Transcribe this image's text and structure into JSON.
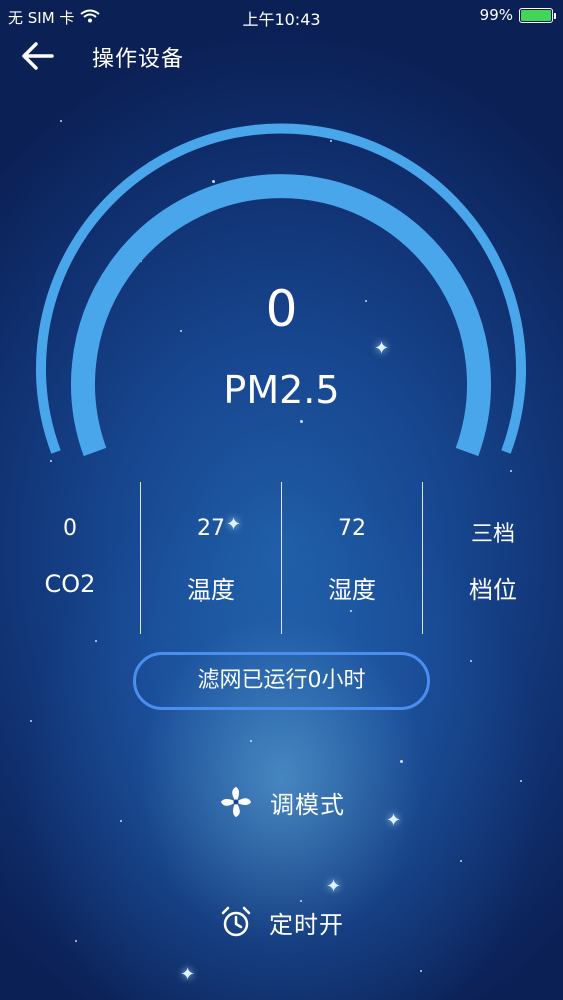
{
  "status_bar": {
    "carrier": "无 SIM 卡",
    "time": "上午10:43",
    "battery_percent_text": "99%",
    "battery_level": 0.99,
    "battery_color": "#41d65a"
  },
  "nav": {
    "title": "操作设备"
  },
  "gauge": {
    "value": "0",
    "label": "PM2.5",
    "arc_color": "#4aa6ea"
  },
  "stats": [
    {
      "value": "0",
      "label": "CO2"
    },
    {
      "value": "27",
      "label": "温度"
    },
    {
      "value": "72",
      "label": "湿度"
    },
    {
      "value": "三档",
      "label": "档位"
    }
  ],
  "filter": {
    "text": "滤网已运行0小时",
    "border_color": "#4a8ef0"
  },
  "actions": {
    "mode_label": "调模式",
    "timer_label": "定时开"
  }
}
